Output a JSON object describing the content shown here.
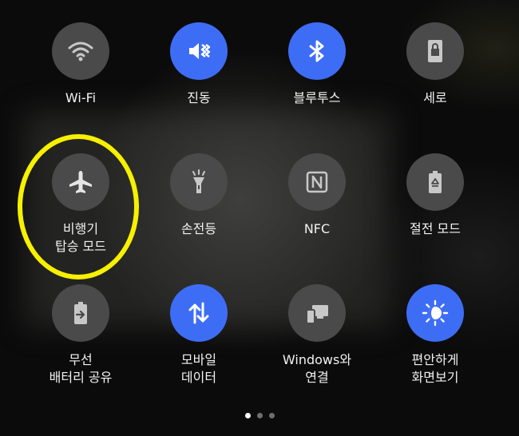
{
  "tiles": [
    {
      "label1": "Wi-Fi",
      "label2": "",
      "icon": "wifi-icon",
      "active": false
    },
    {
      "label1": "진동",
      "label2": "",
      "icon": "vibrate-icon",
      "active": true
    },
    {
      "label1": "블루투스",
      "label2": "",
      "icon": "bluetooth-icon",
      "active": true
    },
    {
      "label1": "세로",
      "label2": "",
      "icon": "portrait-lock-icon",
      "active": false
    },
    {
      "label1": "비행기",
      "label2": "탑승 모드",
      "icon": "airplane-icon",
      "active": false
    },
    {
      "label1": "손전등",
      "label2": "",
      "icon": "flashlight-icon",
      "active": false
    },
    {
      "label1": "NFC",
      "label2": "",
      "icon": "nfc-icon",
      "active": false
    },
    {
      "label1": "절전 모드",
      "label2": "",
      "icon": "power-saving-icon",
      "active": false
    },
    {
      "label1": "무선",
      "label2": "배터리 공유",
      "icon": "wireless-battery-share-icon",
      "active": false
    },
    {
      "label1": "모바일",
      "label2": "데이터",
      "icon": "mobile-data-icon",
      "active": true
    },
    {
      "label1": "Windows와",
      "label2": "연결",
      "icon": "link-to-windows-icon",
      "active": false
    },
    {
      "label1": "편안하게",
      "label2": "화면보기",
      "icon": "eye-comfort-icon",
      "active": true
    }
  ],
  "highlight_color": "#f7f000",
  "accent_color": "#3e6df5",
  "page_indicator": {
    "count": 3,
    "current": 1
  }
}
